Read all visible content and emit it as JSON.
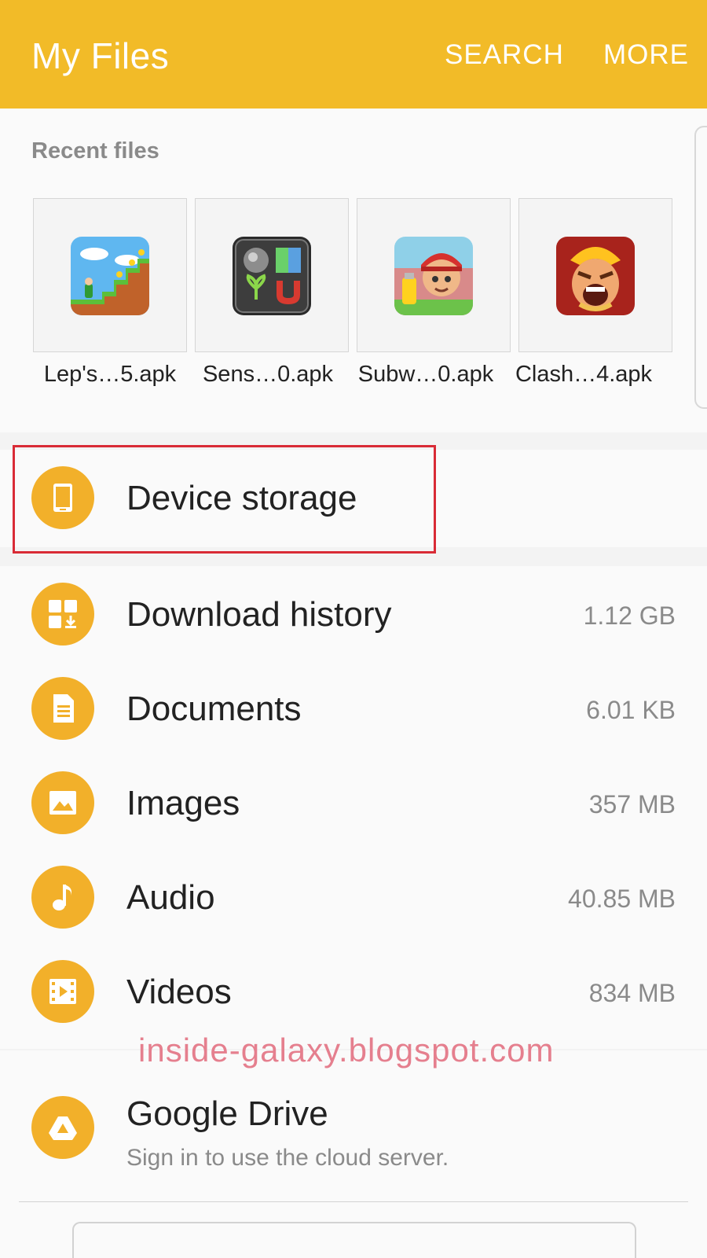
{
  "app_bar": {
    "title": "My Files",
    "search_label": "SEARCH",
    "more_label": "MORE",
    "color": "#f2bb28"
  },
  "recent": {
    "title": "Recent files",
    "items": [
      {
        "label": "Lep's…5.apk",
        "icon": "leps-world-app-icon"
      },
      {
        "label": "Sens…0.apk",
        "icon": "sensors-app-icon"
      },
      {
        "label": "Subw…0.apk",
        "icon": "subway-surfers-app-icon"
      },
      {
        "label": "Clash…4.apk",
        "icon": "clash-of-clans-app-icon"
      }
    ]
  },
  "device_storage": {
    "label": "Device storage",
    "icon": "phone-icon"
  },
  "categories": [
    {
      "label": "Download history",
      "size": "1.12 GB",
      "icon": "download-icon"
    },
    {
      "label": "Documents",
      "size": "6.01 KB",
      "icon": "document-icon"
    },
    {
      "label": "Images",
      "size": "357 MB",
      "icon": "image-icon"
    },
    {
      "label": "Audio",
      "size": "40.85 MB",
      "icon": "music-note-icon"
    },
    {
      "label": "Videos",
      "size": "834 MB",
      "icon": "video-icon"
    }
  ],
  "cloud": {
    "label": "Google Drive",
    "sublabel": "Sign in to use the cloud server.",
    "icon": "google-drive-icon"
  },
  "watermark": "inside-galaxy.blogspot.com",
  "colors": {
    "accent": "#f2b02a",
    "highlight": "#d92b36"
  }
}
